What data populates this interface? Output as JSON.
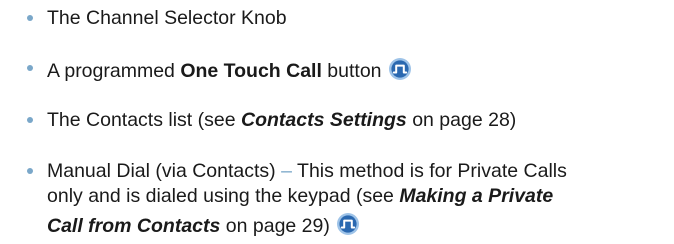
{
  "colors": {
    "bullet": "#7aa7c9",
    "text": "#1a1a1a",
    "icon_fill": "#2a68b0",
    "icon_ring": "#9ec3e8"
  },
  "list": {
    "items": [
      {
        "text": "The Channel Selector Knob"
      },
      {
        "prefix": "A programmed ",
        "bold": "One Touch Call",
        "suffix": " button",
        "icon": "digital-mode-icon"
      },
      {
        "prefix": "The Contacts list (see ",
        "link": "Contacts Settings",
        "suffix": " on page 28)"
      },
      {
        "line1": "Manual Dial (via Contacts)",
        "dash": "–",
        "line1b": "This method is for Private Calls",
        "line2a": "only and is dialed using the keypad (see ",
        "line2link": "Making a Private",
        "line3link": "Call from Contacts",
        "line3b": " on page 29)",
        "icon": "digital-mode-icon"
      }
    ]
  }
}
